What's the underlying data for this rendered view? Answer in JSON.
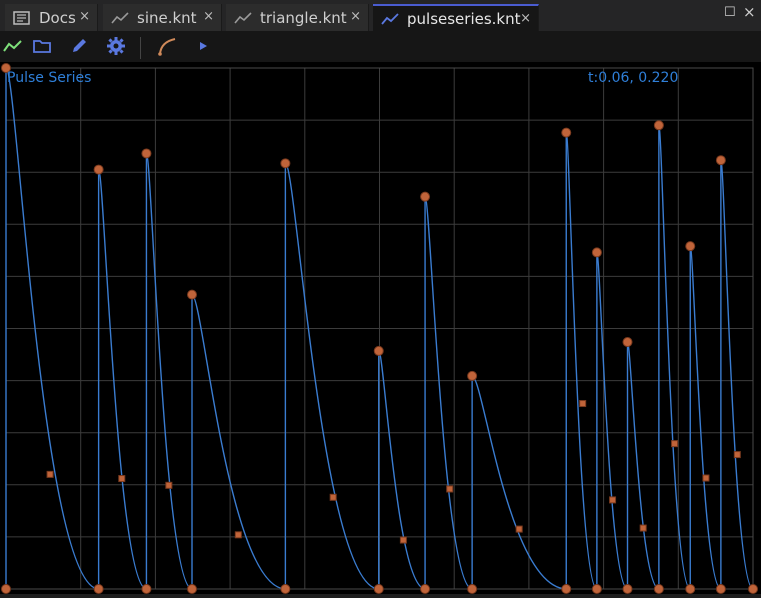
{
  "tabs": [
    {
      "label": "Docs",
      "icon": "docs-icon",
      "active": false
    },
    {
      "label": "sine.knt",
      "icon": "line-chart-icon",
      "active": false
    },
    {
      "label": "triangle.knt",
      "icon": "line-chart-icon",
      "active": false
    },
    {
      "label": "pulseseries.knt",
      "icon": "line-chart-icon",
      "active": true
    }
  ],
  "tab_close_glyph": "×",
  "window": {
    "maximize_glyph": "☐",
    "close_glyph": "×"
  },
  "toolbar": {
    "icons": [
      "chart-icon",
      "folder-icon",
      "pencil-icon",
      "gear-icon",
      "curve-tool-icon",
      "play-icon"
    ]
  },
  "editor": {
    "title": "Pulse Series",
    "readout": "t:0.06, 0.220"
  },
  "colors": {
    "accent": "#4a5cd0",
    "curve": "#3a7cd0",
    "points": "#c0643a",
    "grid": "#3c3c3c",
    "label": "#2f7fd8"
  },
  "curve": {
    "x_range": [
      0,
      1
    ],
    "y_range": [
      0,
      1
    ],
    "pulses": [
      {
        "t0": 0.0,
        "peak": 1.0,
        "handle_t": 0.059,
        "handle_v": 0.22
      },
      {
        "t0": 0.124,
        "peak": 0.805,
        "handle_t": 0.155,
        "handle_v": 0.212
      },
      {
        "t0": 0.188,
        "peak": 0.836,
        "handle_t": 0.218,
        "handle_v": 0.199
      },
      {
        "t0": 0.249,
        "peak": 0.565,
        "handle_t": 0.311,
        "handle_v": 0.104
      },
      {
        "t0": 0.374,
        "peak": 0.817,
        "handle_t": 0.438,
        "handle_v": 0.176
      },
      {
        "t0": 0.499,
        "peak": 0.457,
        "handle_t": 0.532,
        "handle_v": 0.094
      },
      {
        "t0": 0.561,
        "peak": 0.753,
        "handle_t": 0.594,
        "handle_v": 0.192
      },
      {
        "t0": 0.624,
        "peak": 0.409,
        "handle_t": 0.687,
        "handle_v": 0.115
      },
      {
        "t0": 0.75,
        "peak": 0.876,
        "handle_t": 0.772,
        "handle_v": 0.356
      },
      {
        "t0": 0.791,
        "peak": 0.646,
        "handle_t": 0.812,
        "handle_v": 0.171
      },
      {
        "t0": 0.832,
        "peak": 0.474,
        "handle_t": 0.853,
        "handle_v": 0.117
      },
      {
        "t0": 0.874,
        "peak": 0.89,
        "handle_t": 0.895,
        "handle_v": 0.279
      },
      {
        "t0": 0.916,
        "peak": 0.658,
        "handle_t": 0.937,
        "handle_v": 0.213
      },
      {
        "t0": 0.957,
        "peak": 0.823,
        "handle_t": 0.979,
        "handle_v": 0.258
      }
    ],
    "end_t": 1.0
  }
}
